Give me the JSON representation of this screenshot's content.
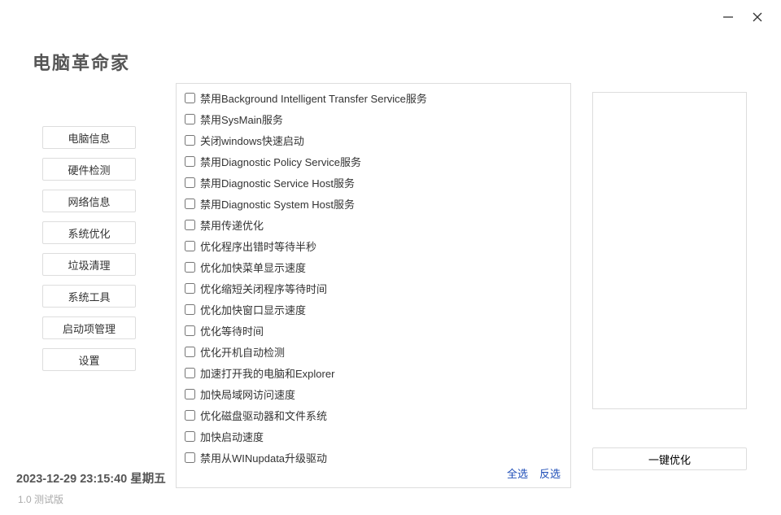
{
  "app_title": "电脑革命家",
  "sidebar": {
    "items": [
      "电脑信息",
      "硬件检测",
      "网络信息",
      "系统优化",
      "垃圾清理",
      "系统工具",
      "启动项管理",
      "设置"
    ]
  },
  "options": [
    "禁用Background Intelligent Transfer Service服务",
    "禁用SysMain服务",
    "关闭windows快速启动",
    "禁用Diagnostic Policy Service服务",
    "禁用Diagnostic Service Host服务",
    "禁用Diagnostic System Host服务",
    "禁用传递优化",
    "优化程序出错时等待半秒",
    "优化加快菜单显示速度",
    "优化缩短关闭程序等待时间",
    "优化加快窗口显示速度",
    "优化等待时间",
    "优化开机自动检测",
    "加速打开我的电脑和Explorer",
    "加快局域网访问速度",
    "优化磁盘驱动器和文件系统",
    "加快启动速度",
    "禁用从WINupdata升级驱动"
  ],
  "links": {
    "select_all": "全选",
    "invert": "反选"
  },
  "optimize_btn": "一键优化",
  "datetime": "2023-12-29 23:15:40  星期五",
  "version": "1.0  测试版"
}
